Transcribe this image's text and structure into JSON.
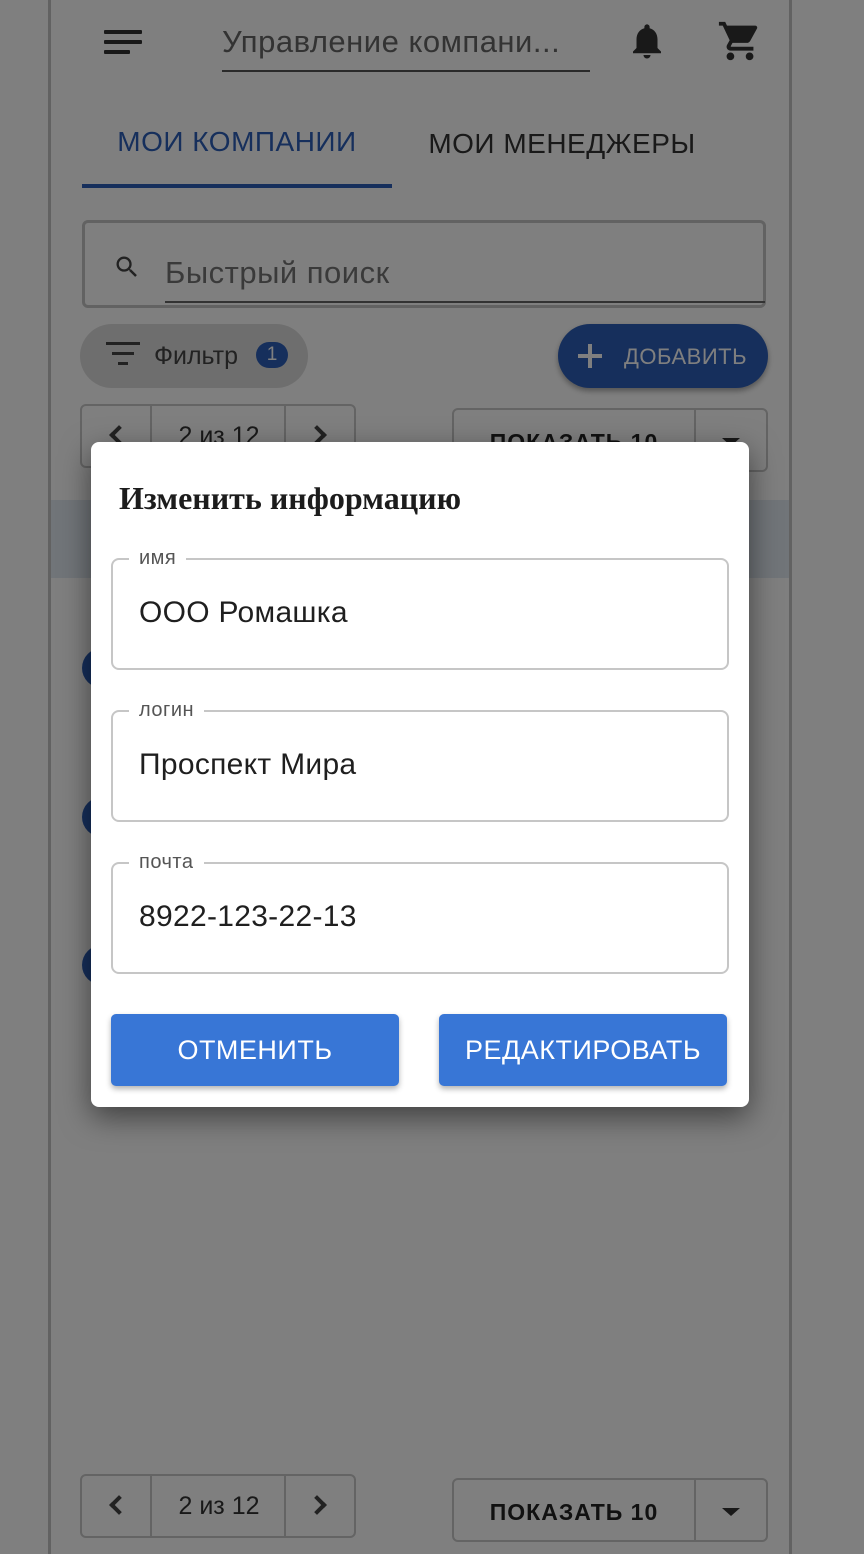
{
  "header": {
    "title": "Управление компани..."
  },
  "tabs": [
    {
      "label": "МОИ КОМПАНИИ",
      "active": true
    },
    {
      "label": "МОИ МЕНЕДЖЕРЫ",
      "active": false
    }
  ],
  "search": {
    "placeholder": "Быстрый поиск"
  },
  "toolbar": {
    "filter_label": "Фильтр",
    "filter_count": "1",
    "add_label": "ДОБАВИТЬ"
  },
  "pagination": {
    "page_text": "2 из 12",
    "page_size_label": "ПОКАЗАТЬ 10"
  },
  "dialog": {
    "title": "Изменить информацию",
    "fields": [
      {
        "label": "имя",
        "value": "ООО Ромашка"
      },
      {
        "label": "логин",
        "value": "Проспект Мира"
      },
      {
        "label": "почта",
        "value": "8922-123-22-13"
      }
    ],
    "cancel_label": "ОТМЕНИТЬ",
    "edit_label": "РЕДАКТИРОВАТЬ"
  },
  "colors": {
    "accent": "#2d5fb8",
    "dialog_button": "#3876d6"
  }
}
